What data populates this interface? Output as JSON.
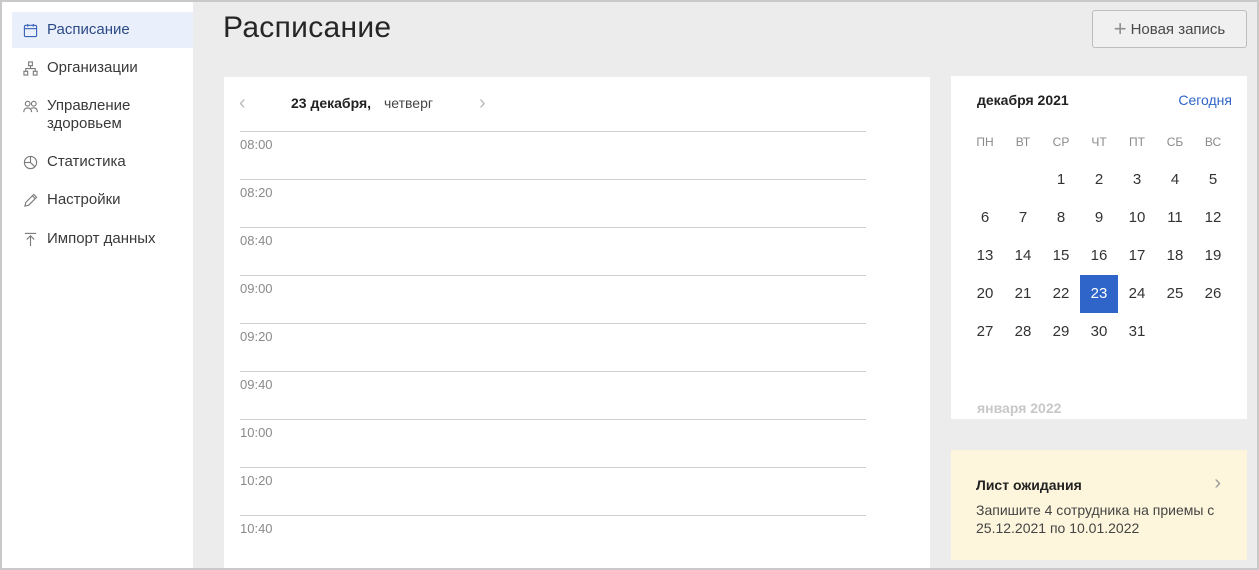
{
  "sidebar": {
    "items": [
      {
        "label": "Расписание",
        "icon": "calendar-icon"
      },
      {
        "label": "Организации",
        "icon": "org-structure-icon"
      },
      {
        "label": "Управление здоровьем",
        "icon": "people-icon"
      },
      {
        "label": "Статистика",
        "icon": "pie-chart-icon"
      },
      {
        "label": "Настройки",
        "icon": "pencil-icon"
      },
      {
        "label": "Импорт данных",
        "icon": "upload-icon"
      }
    ]
  },
  "header": {
    "title": "Расписание",
    "new_button_label": "Новая запись"
  },
  "schedule": {
    "date": "23 декабря,",
    "weekday": "четверг",
    "times": [
      "08:00",
      "08:20",
      "08:40",
      "09:00",
      "09:20",
      "09:40",
      "10:00",
      "10:20",
      "10:40"
    ]
  },
  "calendar": {
    "month": "декабря 2021",
    "today_label": "Сегодня",
    "weekdays": [
      "ПН",
      "ВТ",
      "СР",
      "ЧТ",
      "ПТ",
      "СБ",
      "ВС"
    ],
    "days": [
      "1",
      "2",
      "3",
      "4",
      "5",
      "6",
      "7",
      "8",
      "9",
      "10",
      "11",
      "12",
      "13",
      "14",
      "15",
      "16",
      "17",
      "18",
      "19",
      "20",
      "21",
      "22",
      "23",
      "24",
      "25",
      "26",
      "27",
      "28",
      "29",
      "30",
      "31"
    ],
    "selected_day": "23",
    "next_month": "января 2022",
    "accent_color": "#2f64c8"
  },
  "waiting_list": {
    "title": "Лист ожидания",
    "text": "Запишите 4 сотрудника на приемы с 25.12.2021 по 10.01.2022"
  }
}
